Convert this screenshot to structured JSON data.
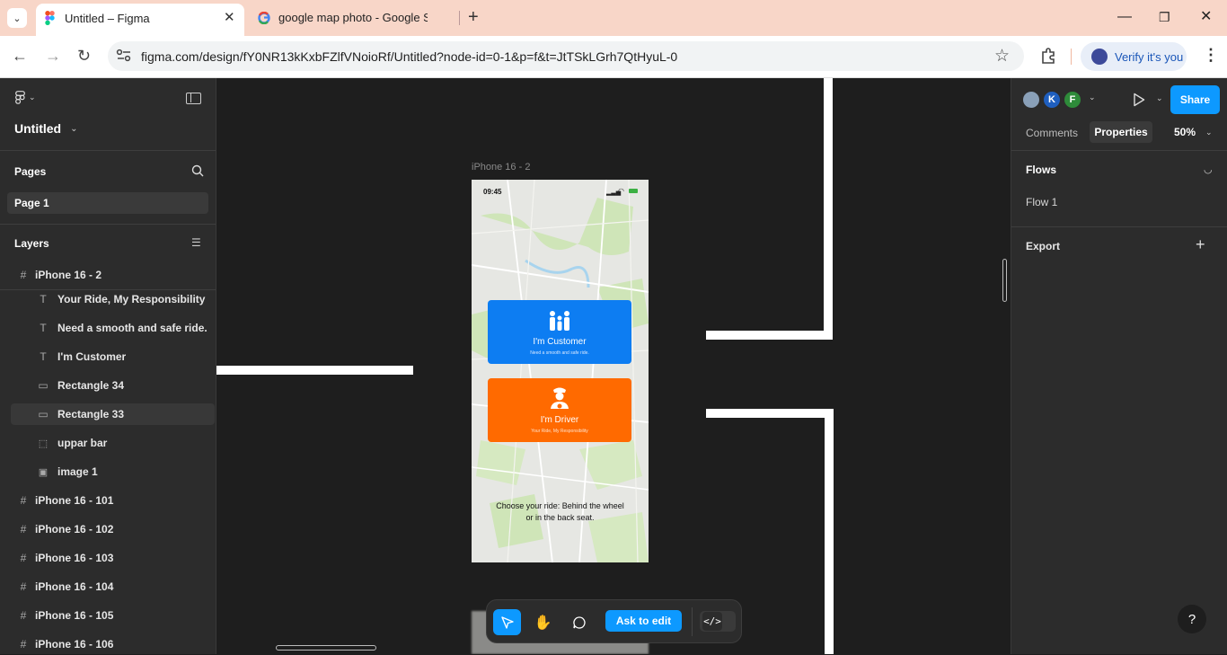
{
  "browser": {
    "tabs": [
      {
        "title": "Untitled – Figma",
        "icon": "figma-logo-icon"
      },
      {
        "title": "google map photo - Google Se",
        "icon": "google-logo-icon"
      }
    ],
    "url": "figma.com/design/fY0NR13kKxbFZlfVNoioRf/Untitled?node-id=0-1&p=f&t=JtTSkLGrh7QtHyuL-0",
    "verify_label": "Verify it's you"
  },
  "figma": {
    "file_name": "Untitled",
    "pages_title": "Pages",
    "current_page": "Page 1",
    "layers_title": "Layers",
    "layers": [
      {
        "name": "iPhone 16 - 2",
        "type": "frame",
        "indent": 0
      },
      {
        "name": "Your Ride, My Responsibility",
        "type": "text",
        "indent": 1
      },
      {
        "name": "Need a smooth and safe ride.",
        "type": "text",
        "indent": 1
      },
      {
        "name": "I'm Customer",
        "type": "text",
        "indent": 1
      },
      {
        "name": "Rectangle 34",
        "type": "rect",
        "indent": 1
      },
      {
        "name": "Rectangle 33",
        "type": "rect",
        "indent": 1
      },
      {
        "name": "uppar bar",
        "type": "group",
        "indent": 1
      },
      {
        "name": "image 1",
        "type": "image",
        "indent": 1
      },
      {
        "name": "iPhone 16 - 101",
        "type": "frame",
        "indent": 0
      },
      {
        "name": "iPhone 16 - 102",
        "type": "frame",
        "indent": 0
      },
      {
        "name": "iPhone 16 - 103",
        "type": "frame",
        "indent": 0
      },
      {
        "name": "iPhone 16 - 104",
        "type": "frame",
        "indent": 0
      },
      {
        "name": "iPhone 16 - 105",
        "type": "frame",
        "indent": 0
      },
      {
        "name": "iPhone 16 - 106",
        "type": "frame",
        "indent": 0
      }
    ],
    "avatars": [
      {
        "letter": "",
        "color": "#8aa0b8"
      },
      {
        "letter": "K",
        "color": "#1f5fbf"
      },
      {
        "letter": "F",
        "color": "#2e8b3a"
      }
    ],
    "share_label": "Share",
    "tabs": {
      "comments": "Comments",
      "properties": "Properties"
    },
    "zoom": "50%",
    "flows_title": "Flows",
    "flow_item": "Flow 1",
    "export_title": "Export",
    "help": "?"
  },
  "frame": {
    "label": "iPhone 16 - 2",
    "time": "09:45",
    "customer": {
      "title": "I'm Customer",
      "subtitle": "Need a smooth and safe ride.",
      "color": "#0d7df2"
    },
    "driver": {
      "title": "I'm Driver",
      "subtitle": "Your Ride, My Responsibility",
      "color": "#ff6a00"
    },
    "footer": "Choose your ride: Behind the wheel or in the back seat."
  },
  "toolbar": {
    "ask_label": "Ask to edit"
  }
}
